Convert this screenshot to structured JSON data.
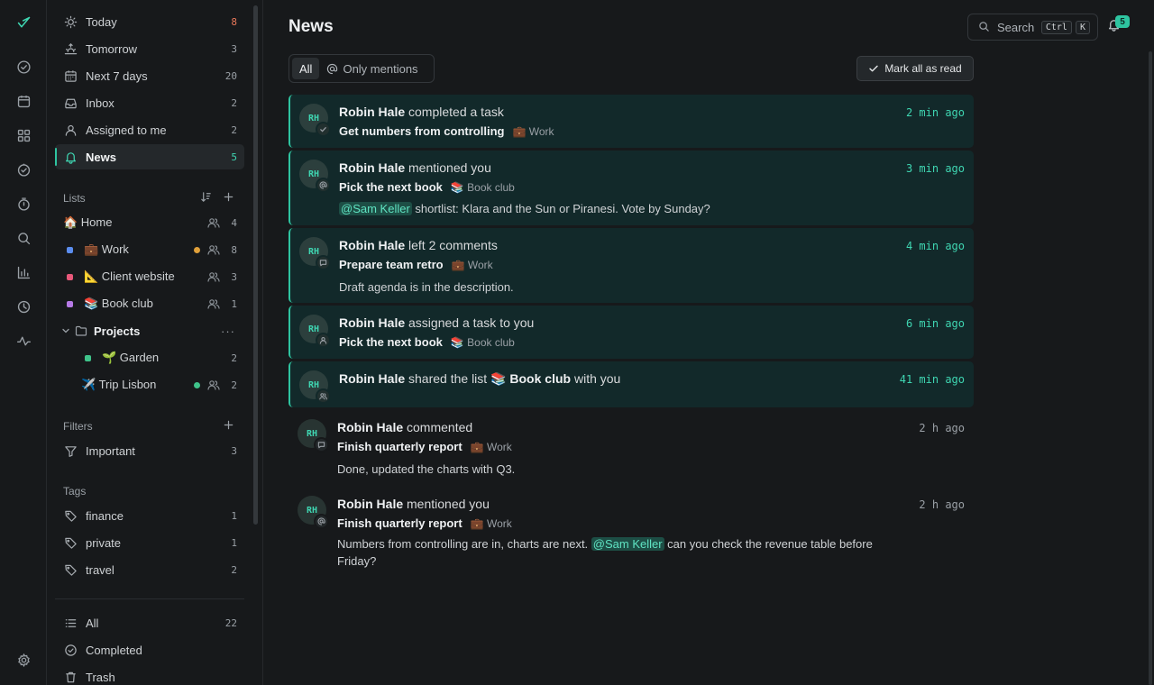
{
  "rail": {
    "items": [
      "logo",
      "tasks",
      "calendar",
      "apps",
      "done",
      "timer",
      "search",
      "stats",
      "history",
      "activity",
      "settings"
    ]
  },
  "nav": [
    {
      "label": "Today",
      "count": "8",
      "icon": "sun-icon"
    },
    {
      "label": "Tomorrow",
      "count": "3",
      "icon": "sunrise-icon"
    },
    {
      "label": "Next 7 days",
      "count": "20",
      "icon": "calendar-icon"
    },
    {
      "label": "Inbox",
      "count": "2",
      "icon": "inbox-icon"
    },
    {
      "label": "Assigned to me",
      "count": "2",
      "icon": "user-icon"
    },
    {
      "label": "News",
      "count": "5",
      "icon": "bell-icon"
    }
  ],
  "lists_title": "Lists",
  "lists": [
    {
      "label": "🏠 Home",
      "count": "4",
      "color": ""
    },
    {
      "label": "💼 Work",
      "count": "8",
      "color": "#5b8def",
      "dot": "#e0a03a"
    },
    {
      "label": "📐 Client website",
      "count": "3",
      "color": "#e8587a"
    },
    {
      "label": "📚 Book club",
      "count": "1",
      "color": "#b67ae6"
    }
  ],
  "projects": {
    "label": "Projects",
    "children": [
      {
        "label": "🌱 Garden",
        "count": "2",
        "color": "#3fc38a"
      },
      {
        "label": "✈️ Trip Lisbon",
        "count": "2",
        "dot": "#3fc38a"
      }
    ]
  },
  "filters_title": "Filters",
  "filters": [
    {
      "label": "Important",
      "count": "3"
    }
  ],
  "tags_title": "Tags",
  "tags": [
    {
      "label": "finance",
      "count": "1"
    },
    {
      "label": "private",
      "count": "1"
    },
    {
      "label": "travel",
      "count": "2"
    }
  ],
  "bottom": [
    {
      "label": "All",
      "count": "22"
    },
    {
      "label": "Completed",
      "count": ""
    },
    {
      "label": "Trash",
      "count": ""
    }
  ],
  "header": {
    "title": "News",
    "search_label": "Search",
    "kbd1": "Ctrl",
    "kbd2": "K",
    "notif_count": "5"
  },
  "segment": {
    "all": "All",
    "mentions": "Only mentions"
  },
  "mark_all": "Mark all as read",
  "accent": "#2ec4a0",
  "news": [
    {
      "initials": "RH",
      "actor": "Robin Hale",
      "action": "completed a task",
      "time": "2 min ago",
      "task": "Get numbers from controlling",
      "list": "💼 Work",
      "kind": "check",
      "unread": true
    },
    {
      "initials": "RH",
      "actor": "Robin Hale",
      "action": "mentioned you",
      "time": "3 min ago",
      "task": "Pick the next book",
      "list": "📚 Book club",
      "kind": "at",
      "unread": true,
      "mention": "@Sam Keller",
      "text": " shortlist: Klara and the Sun or Piranesi. Vote by Sunday?"
    },
    {
      "initials": "RH",
      "actor": "Robin Hale",
      "action": "left 2 comments",
      "time": "4 min ago",
      "task": "Prepare team retro",
      "list": "💼 Work",
      "kind": "comment",
      "unread": true,
      "text": "Draft agenda is in the description."
    },
    {
      "initials": "RH",
      "actor": "Robin Hale",
      "action": "assigned a task to you",
      "time": "6 min ago",
      "task": "Pick the next book",
      "list": "📚 Book club",
      "kind": "user",
      "unread": true
    },
    {
      "initials": "RH",
      "actor": "Robin Hale",
      "action": "shared the list",
      "list_name": "📚 Book club",
      "action_tail": "with you",
      "time": "41 min ago",
      "kind": "users",
      "unread": true
    },
    {
      "initials": "RH",
      "actor": "Robin Hale",
      "action": "commented",
      "time": "2 h ago",
      "task": "Finish quarterly report",
      "list": "💼 Work",
      "kind": "comment",
      "unread": false,
      "text": "Done, updated the charts with Q3."
    },
    {
      "initials": "RH",
      "actor": "Robin Hale",
      "action": "mentioned you",
      "time": "2 h ago",
      "task": "Finish quarterly report",
      "list": "💼 Work",
      "kind": "at",
      "unread": false,
      "mention": "@Sam Keller",
      "text_before": "Numbers from controlling are in, charts are next. ",
      "text": " can you check the revenue table before Friday?"
    }
  ]
}
